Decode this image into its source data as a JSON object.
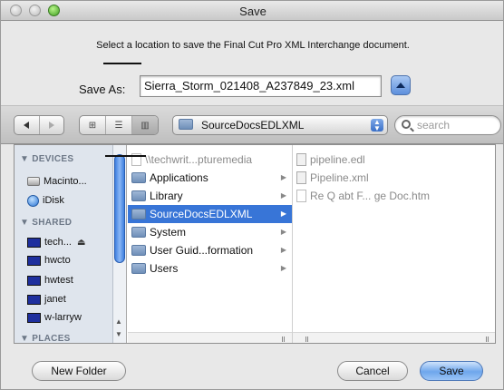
{
  "window": {
    "title": "Save"
  },
  "message": "Select a location to save the Final Cut Pro XML Interchange document.",
  "save_as": {
    "label": "Save As:",
    "value": "Sierra_Storm_021408_A237849_23.xml"
  },
  "path_popup": {
    "value": "SourceDocsEDLXML"
  },
  "search": {
    "placeholder": "search"
  },
  "sidebar": {
    "devices_header": "DEVICES",
    "shared_header": "SHARED",
    "places_header": "PLACES",
    "devices": [
      {
        "label": "Macinto..."
      },
      {
        "label": "iDisk"
      }
    ],
    "shared": [
      {
        "label": "tech..."
      },
      {
        "label": "hwcto"
      },
      {
        "label": "hwtest"
      },
      {
        "label": "janet"
      },
      {
        "label": "w-larryw"
      }
    ]
  },
  "column1": {
    "items": [
      {
        "label": "\\\\techwrit...pturemedia"
      },
      {
        "label": "Applications"
      },
      {
        "label": "Library"
      },
      {
        "label": "SourceDocsEDLXML"
      },
      {
        "label": "System"
      },
      {
        "label": "User Guid...formation"
      },
      {
        "label": "Users"
      }
    ]
  },
  "column2": {
    "items": [
      {
        "label": "pipeline.edl"
      },
      {
        "label": "Pipeline.xml"
      },
      {
        "label": "Re Q abt F... ge Doc.htm"
      }
    ]
  },
  "buttons": {
    "new_folder": "New Folder",
    "cancel": "Cancel",
    "save": "Save"
  },
  "colors": {
    "selection": "#3875d7",
    "default_button": "#6ea6ec",
    "zoom_light": "#3f9e21"
  }
}
